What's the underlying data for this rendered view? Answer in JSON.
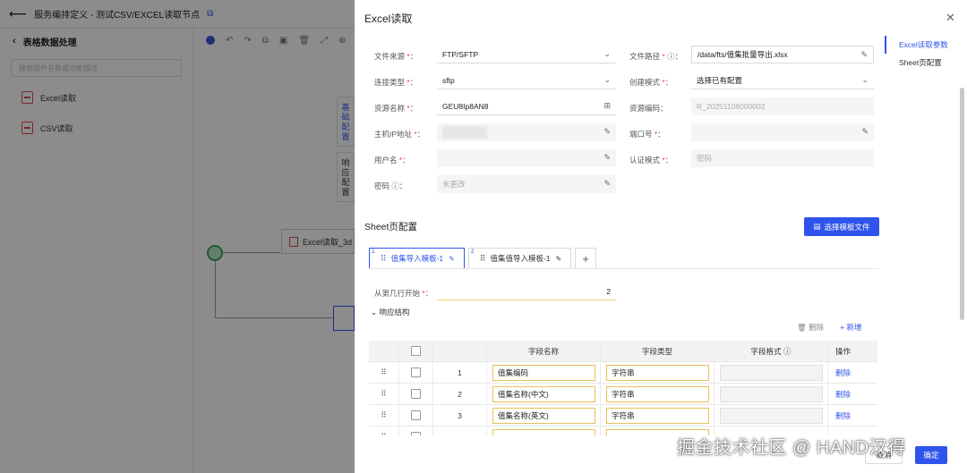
{
  "app": {
    "title": "服务编排定义 - 测试CSV/EXCEL读取节点",
    "left_title": "表格数据处理",
    "search_placeholder": "搜索组件名称或功能描述",
    "left_items": [
      {
        "label": "Excel读取"
      },
      {
        "label": "CSV读取"
      }
    ],
    "canvas_node_label": "Excel读取_3d",
    "side_tabs": [
      "基础配置",
      "响应配置"
    ]
  },
  "drawer": {
    "title": "Excel读取",
    "anchors": [
      "Excel读取参数",
      "Sheet页配置"
    ],
    "fields": {
      "file_source": {
        "label": "文件来源",
        "value": "FTP/SFTP"
      },
      "file_path": {
        "label": "文件路径",
        "value": "/data/fts/值集批量导出.xlsx"
      },
      "conn_type": {
        "label": "连接类型",
        "value": "sftp"
      },
      "create_mode": {
        "label": "创建模式",
        "value": "选择已有配置"
      },
      "resource_name": {
        "label": "资源名称",
        "value": "GEU8Ip8AN8"
      },
      "resource_code": {
        "label": "资源编码",
        "value": "R_20251106000002"
      },
      "host": {
        "label": "主机IP地址"
      },
      "port": {
        "label": "端口号"
      },
      "username": {
        "label": "用户名"
      },
      "auth_mode": {
        "label": "认证模式",
        "value": "密码"
      },
      "password": {
        "label": "密码",
        "value": "未更改"
      }
    },
    "sheet": {
      "section_title": "Sheet页配置",
      "choose_button": "选择模板文件",
      "tabs": [
        {
          "index": "1",
          "label": "值集导入模板-1"
        },
        {
          "index": "2",
          "label": "值集值导入模板-1"
        }
      ],
      "start_row_label": "从第几行开始",
      "start_row_value": "2",
      "response_toggle": "响应结构",
      "delete_label": "删除",
      "add_label": "新增",
      "columns": [
        "字段名称",
        "字段类型",
        "字段格式",
        "操作"
      ],
      "rows": [
        {
          "no": "1",
          "name": "值集编码",
          "type": "字符串",
          "format": "",
          "action": "删除"
        },
        {
          "no": "2",
          "name": "值集名称(中文)",
          "type": "字符串",
          "format": "",
          "action": "删除"
        },
        {
          "no": "3",
          "name": "值集名称(英文)",
          "type": "字符串",
          "format": "",
          "action": "删除"
        }
      ]
    },
    "footer": {
      "cancel": "取消",
      "ok": "确定"
    }
  },
  "watermark": "掘金技术社区 @ HAND汉得",
  "colors": {
    "primary": "#2f54eb",
    "required": "#e0464e",
    "start_node": "#40a060"
  }
}
